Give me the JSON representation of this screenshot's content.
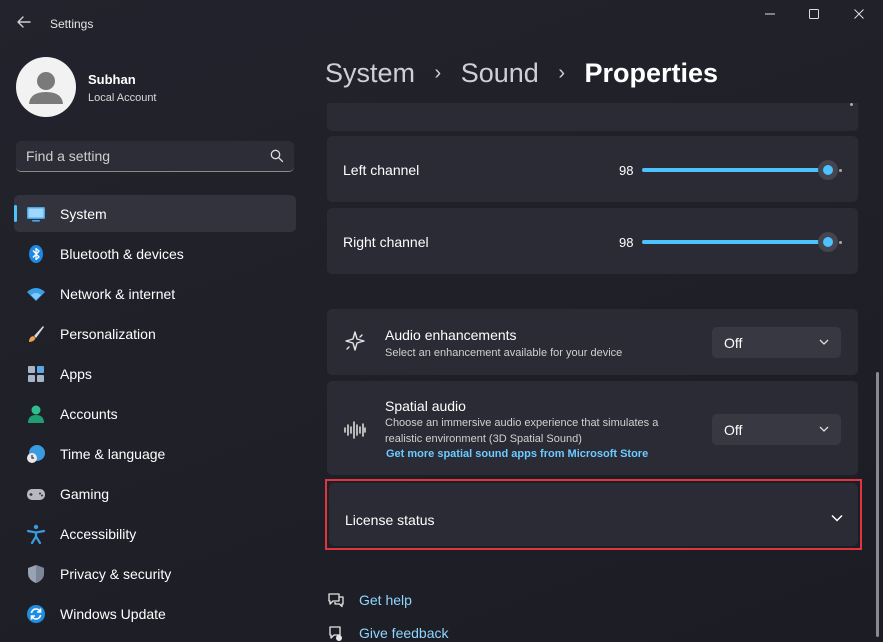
{
  "window": {
    "title": "Settings"
  },
  "account": {
    "name": "Subhan",
    "type": "Local Account"
  },
  "search": {
    "placeholder": "Find a setting"
  },
  "nav": [
    {
      "label": "System",
      "icon": "monitor-icon",
      "active": true
    },
    {
      "label": "Bluetooth & devices",
      "icon": "bluetooth-icon"
    },
    {
      "label": "Network & internet",
      "icon": "wifi-icon"
    },
    {
      "label": "Personalization",
      "icon": "brush-icon"
    },
    {
      "label": "Apps",
      "icon": "apps-icon"
    },
    {
      "label": "Accounts",
      "icon": "person-icon"
    },
    {
      "label": "Time & language",
      "icon": "globe-clock-icon"
    },
    {
      "label": "Gaming",
      "icon": "gamepad-icon"
    },
    {
      "label": "Accessibility",
      "icon": "accessibility-icon"
    },
    {
      "label": "Privacy & security",
      "icon": "shield-icon"
    },
    {
      "label": "Windows Update",
      "icon": "update-icon"
    }
  ],
  "breadcrumb": {
    "level1": "System",
    "level2": "Sound",
    "current": "Properties",
    "separator": "›"
  },
  "left_channel": {
    "label": "Left channel",
    "value": "98"
  },
  "right_channel": {
    "label": "Right channel",
    "value": "98"
  },
  "audio_enhancements": {
    "title": "Audio enhancements",
    "description": "Select an enhancement available for your device",
    "value": "Off"
  },
  "spatial_audio": {
    "title": "Spatial audio",
    "description": "Choose an immersive audio experience that simulates a realistic environment (3D Spatial Sound)",
    "link": "Get more spatial sound apps from Microsoft Store",
    "value": "Off"
  },
  "license_status": {
    "label": "License status"
  },
  "footer": {
    "get_help": "Get help",
    "give_feedback": "Give feedback"
  },
  "colors": {
    "accent": "#4cc2ff",
    "highlight_border": "#e0353f",
    "background": "#202028",
    "card": "#2b2b35"
  }
}
